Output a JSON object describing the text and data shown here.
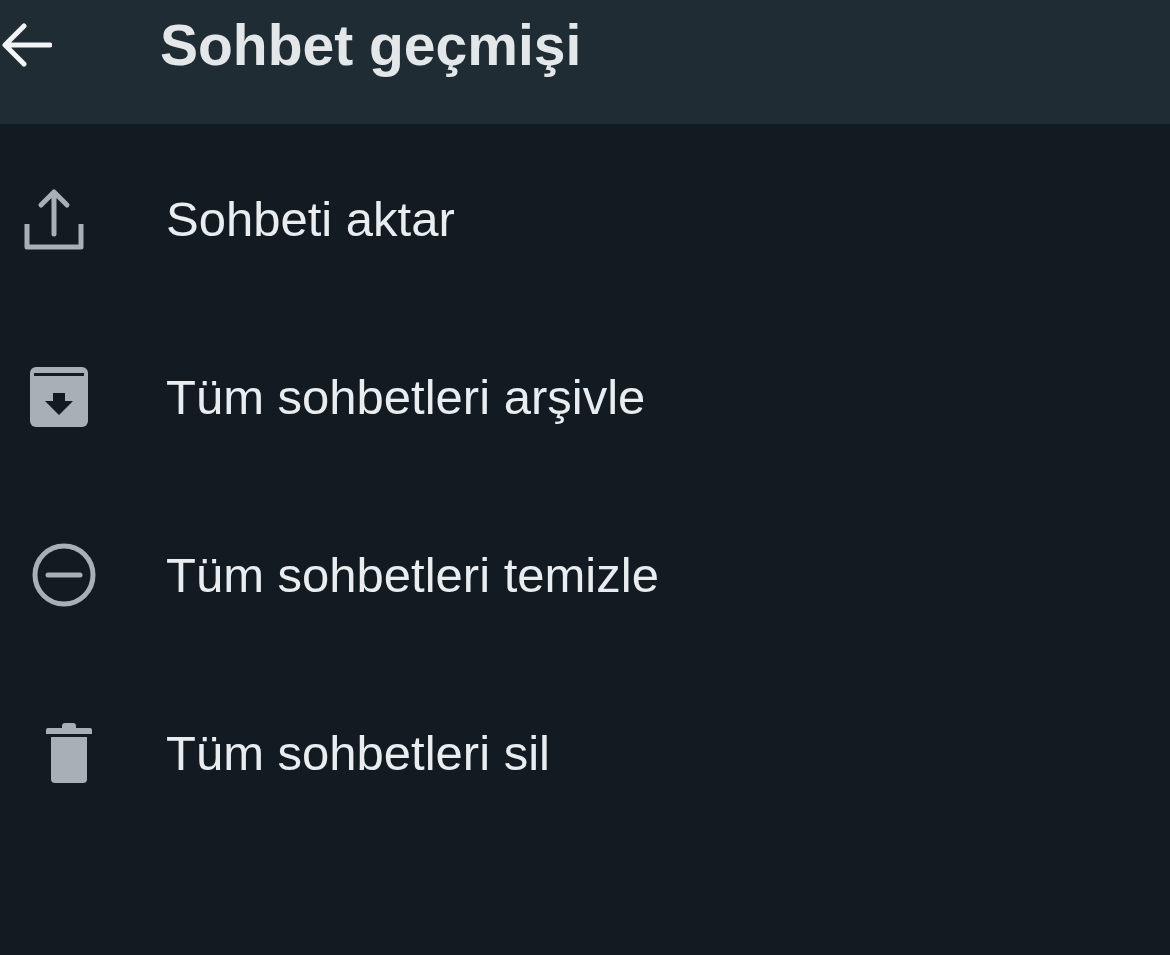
{
  "header": {
    "title": "Sohbet geçmişi"
  },
  "items": [
    {
      "kind": "export",
      "label": "Sohbeti aktar"
    },
    {
      "kind": "archive",
      "label": "Tüm sohbetleri arşivle"
    },
    {
      "kind": "clear",
      "label": "Tüm sohbetleri temizle"
    },
    {
      "kind": "delete",
      "label": "Tüm sohbetleri sil"
    }
  ]
}
